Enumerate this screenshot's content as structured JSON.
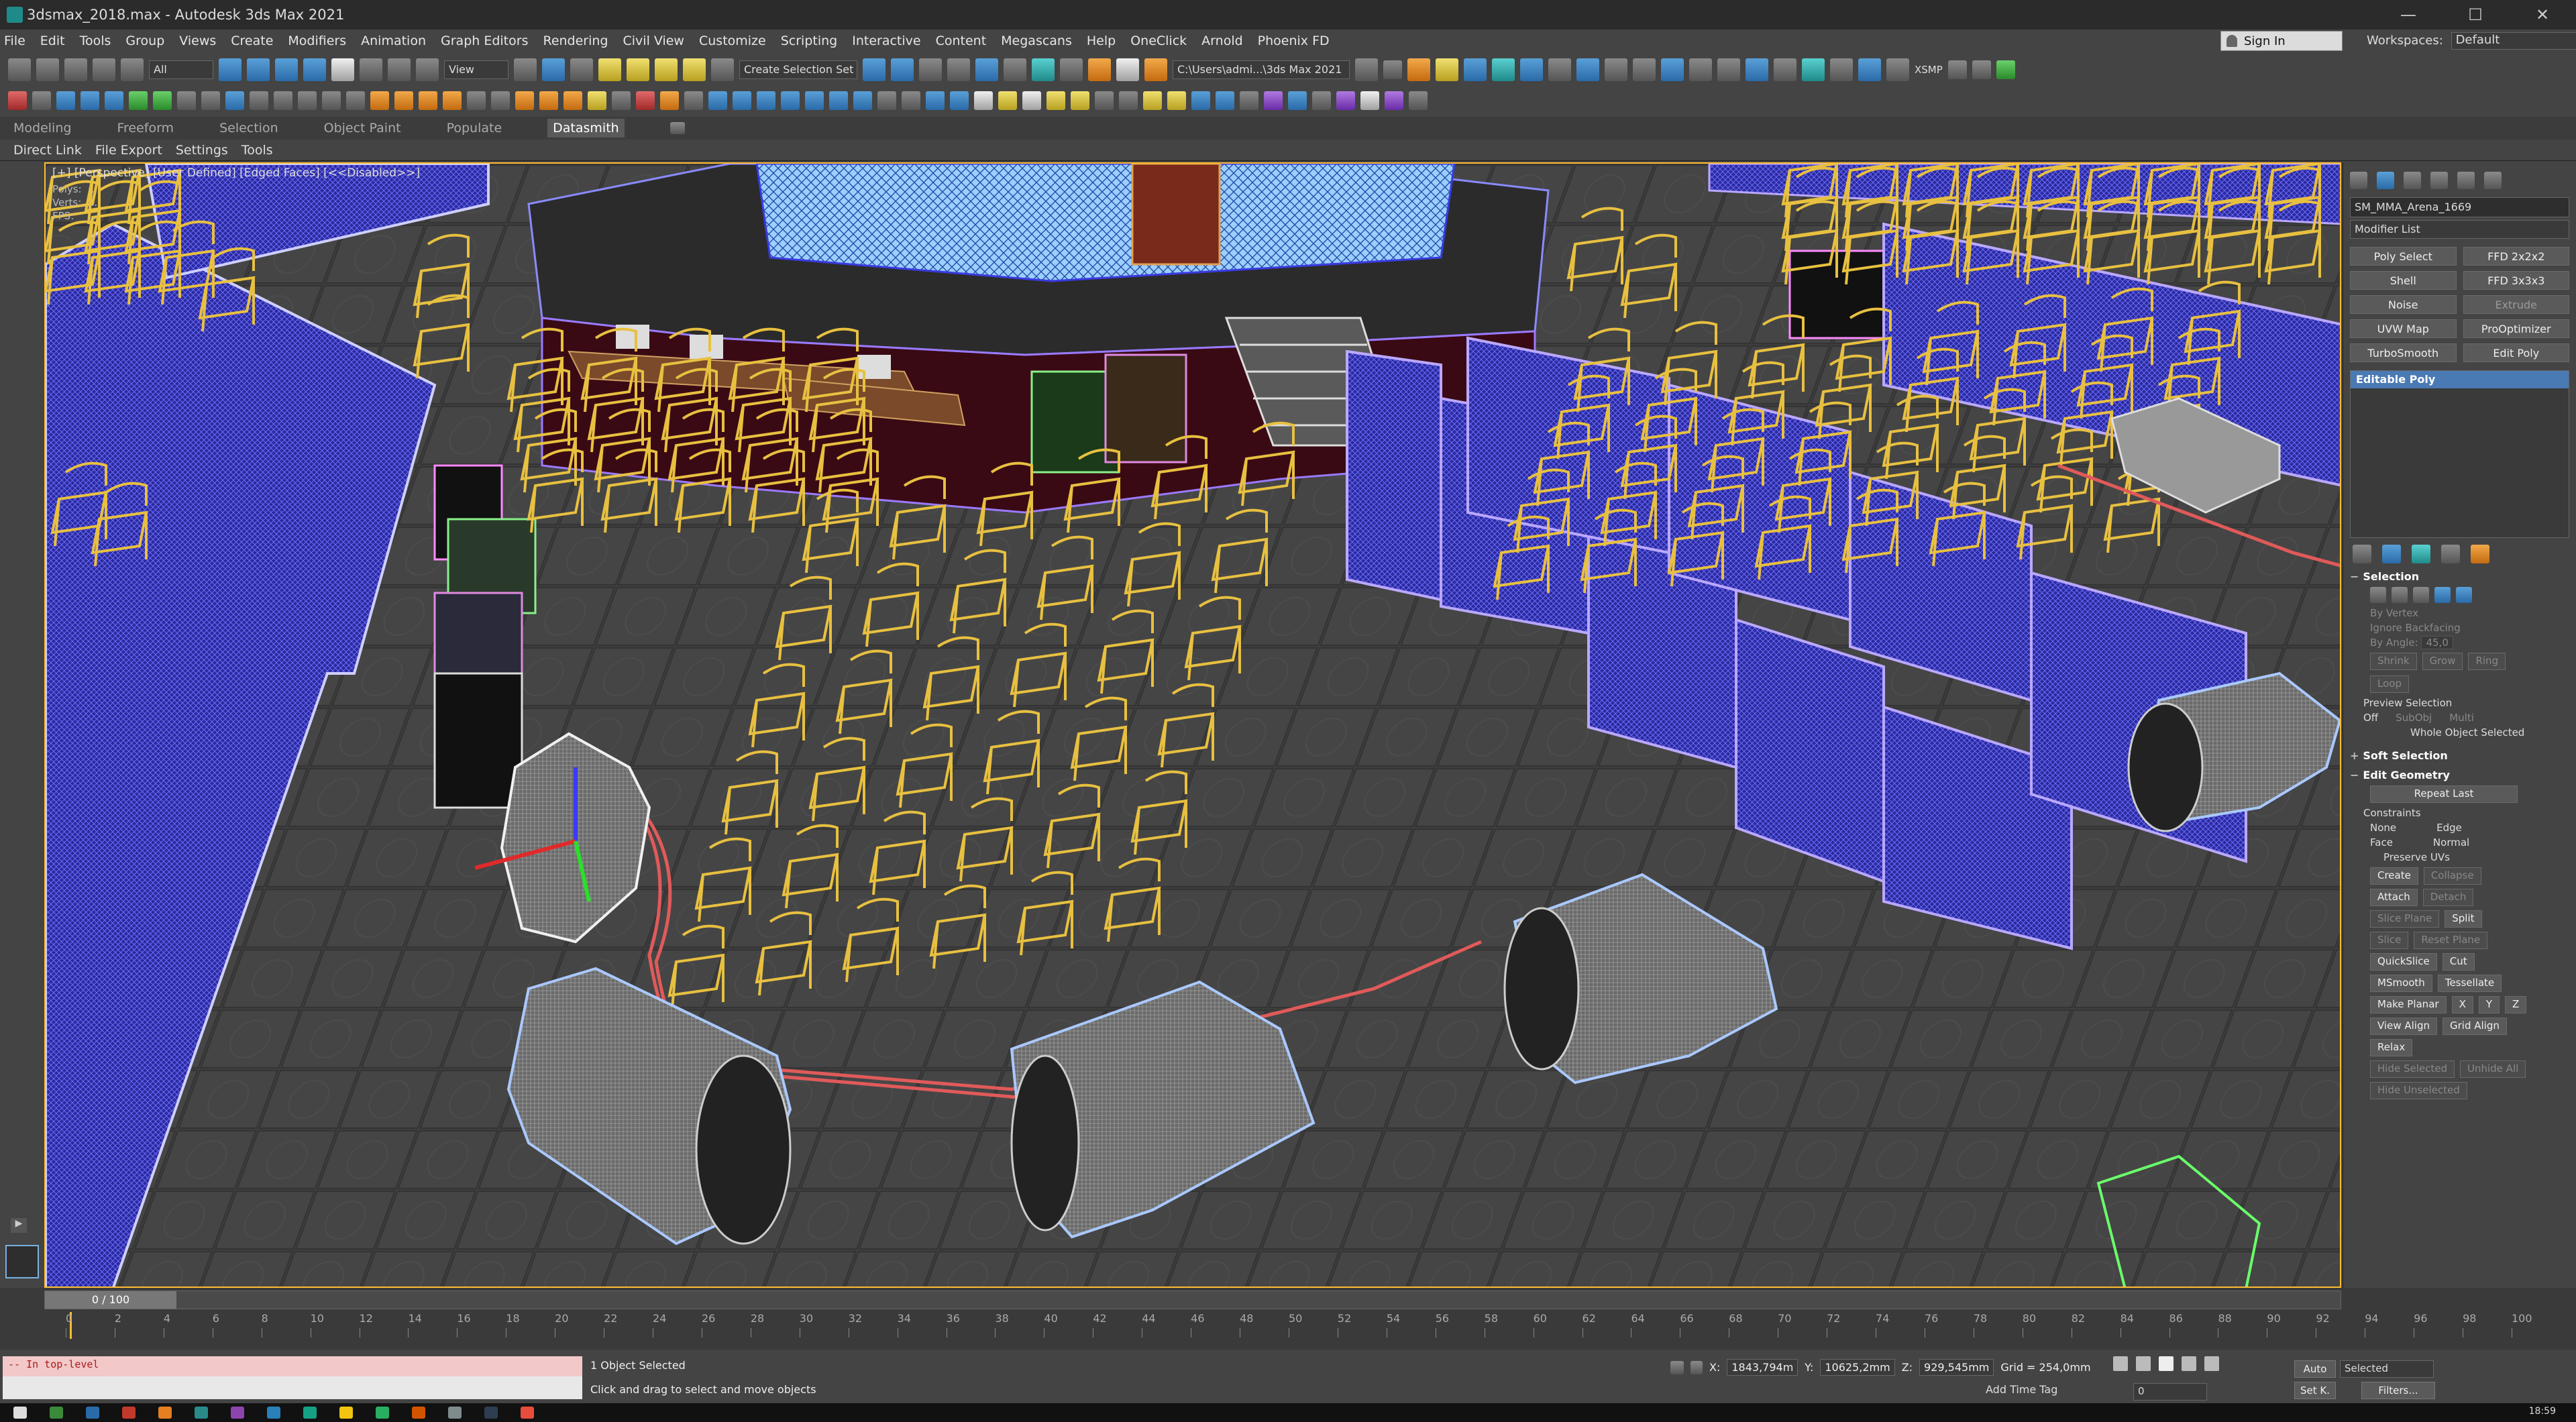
{
  "titlebar": {
    "title": "3dsmax_2018.max - Autodesk 3ds Max 2021",
    "buttons": [
      "—",
      "☐",
      "✕"
    ]
  },
  "menu": {
    "items": [
      "File",
      "Edit",
      "Tools",
      "Group",
      "Views",
      "Create",
      "Modifiers",
      "Animation",
      "Graph Editors",
      "Rendering",
      "Civil View",
      "Customize",
      "Scripting",
      "Interactive",
      "Content",
      "Megascans",
      "Help",
      "OneClick",
      "Arnold",
      "Phoenix FD"
    ]
  },
  "account": {
    "signin": "Sign In",
    "workspaces_label": "Workspaces:",
    "workspace": "Default"
  },
  "toolbar": {
    "selection_filter": "All",
    "reference_coord": "View",
    "named_selection": "Create Selection Set",
    "project_path": "C:\\Users\\admi...\\3ds Max 2021",
    "xsmp": "XSMP"
  },
  "ribbon": {
    "tabs": [
      "Modeling",
      "Freeform",
      "Selection",
      "Object Paint",
      "Populate",
      "Datasmith"
    ],
    "active": "Datasmith"
  },
  "subribbon": {
    "items": [
      "Direct Link",
      "File Export",
      "Settings",
      "Tools"
    ]
  },
  "viewport": {
    "label": "[+] [Perspective] [User Defined] [Edged Faces] [<<Disabled>>]",
    "stats": "Polys:  ...\nVerts:  ...\nFPS:    ..."
  },
  "command_panel": {
    "object_name": "SM_MMA_Arena_1669",
    "modifier_list": "Modifier List",
    "modifier_buttons": [
      "Poly Select",
      "FFD 2x2x2",
      "Shell",
      "FFD 3x3x3",
      "Noise",
      "Extrude",
      "UVW Map",
      "ProOptimizer",
      "TurboSmooth",
      "Edit Poly"
    ],
    "stack_item": "Editable Poly",
    "selection_rollout": {
      "title": "Selection",
      "by_vertex": "By Vertex",
      "ignore_backfacing": "Ignore Backfacing",
      "by_angle": "By Angle:",
      "angle_value": "45,0",
      "shrink": "Shrink",
      "grow": "Grow",
      "ring": "Ring",
      "loop": "Loop",
      "preview_selection": "Preview Selection",
      "off": "Off",
      "subobj": "SubObj",
      "multi": "Multi",
      "whole_object": "Whole Object Selected"
    },
    "soft_selection": "Soft Selection",
    "edit_geometry": {
      "title": "Edit Geometry",
      "repeat_last": "Repeat Last",
      "constraints": "Constraints",
      "none": "None",
      "edge": "Edge",
      "face": "Face",
      "normal": "Normal",
      "preserve_uvs": "Preserve UVs",
      "create": "Create",
      "collapse": "Collapse",
      "attach": "Attach",
      "detach": "Detach",
      "slice_plane": "Slice Plane",
      "split": "Split",
      "slice": "Slice",
      "reset_plane": "Reset Plane",
      "quickslice": "QuickSlice",
      "cut": "Cut",
      "msmooth": "MSmooth",
      "tessellate": "Tessellate",
      "make_planar": "Make Planar",
      "x": "X",
      "y": "Y",
      "z": "Z",
      "view_align": "View Align",
      "grid_align": "Grid Align",
      "relax": "Relax",
      "hide_selected": "Hide Selected",
      "unhide_all": "Unhide All",
      "hide_unselected": "Hide Unselected"
    }
  },
  "timeline": {
    "frame_display": "0 / 100",
    "ticks": [
      "0",
      "2",
      "4",
      "6",
      "8",
      "10",
      "12",
      "14",
      "16",
      "18",
      "20",
      "22",
      "24",
      "26",
      "28",
      "30",
      "32",
      "34",
      "36",
      "38",
      "40",
      "42",
      "44",
      "46",
      "48",
      "50",
      "52",
      "54",
      "56",
      "58",
      "60",
      "62",
      "64",
      "66",
      "68",
      "70",
      "72",
      "74",
      "76",
      "78",
      "80",
      "82",
      "84",
      "86",
      "88",
      "90",
      "92",
      "94",
      "96",
      "98",
      "100"
    ]
  },
  "status": {
    "maxscript": "-- In top-level",
    "selected": "1 Object Selected",
    "prompt": "Click and drag to select and move objects",
    "x_label": "X:",
    "x": "1843,794m",
    "y_label": "Y:",
    "y": "10625,2mm",
    "z_label": "Z:",
    "z": "929,545mm",
    "grid": "Grid = 254,0mm",
    "add_time_tag": "Add Time Tag",
    "frame": "0",
    "auto": "Auto",
    "setk": "Set K.",
    "selected_set": "Selected",
    "filters": "Filters..."
  },
  "taskbar": {
    "clock": "18:59"
  },
  "colors": {
    "accent": "#4a7ab4",
    "viewport_border": "#ffbd30",
    "fence": "#4a4ad8",
    "chairs": "#e0c040",
    "speakers": "#8aa0c0",
    "cables": "#e05a5a"
  }
}
